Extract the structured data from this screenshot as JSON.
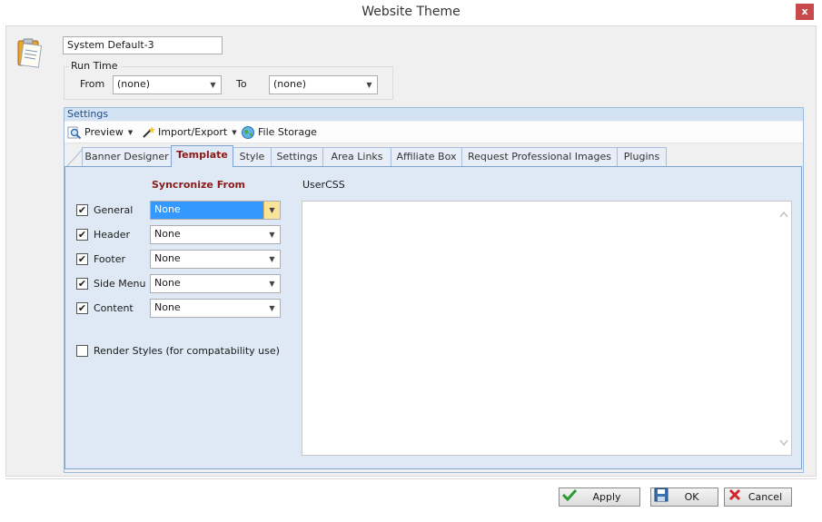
{
  "window": {
    "title": "Website Theme",
    "close_glyph": "x"
  },
  "theme_name": "System Default-3",
  "run_time": {
    "legend": "Run Time",
    "from_label": "From",
    "from_value": "(none)",
    "to_label": "To",
    "to_value": "(none)"
  },
  "settings": {
    "header": "Settings",
    "toolbar": {
      "preview": "Preview",
      "import_export": "Import/Export",
      "file_storage": "File Storage"
    },
    "tabs": [
      {
        "label": "Banner Designer"
      },
      {
        "label": "Template"
      },
      {
        "label": "Style"
      },
      {
        "label": "Settings"
      },
      {
        "label": "Area Links"
      },
      {
        "label": "Affiliate Box"
      },
      {
        "label": "Request Professional Images"
      },
      {
        "label": "Plugins"
      }
    ],
    "active_tab": "Template"
  },
  "template": {
    "sync_title": "Syncronize From",
    "usercss_label": "UserCSS",
    "usercss_value": "",
    "rows": [
      {
        "label": "General",
        "checked": true,
        "value": "None"
      },
      {
        "label": "Header",
        "checked": true,
        "value": "None"
      },
      {
        "label": "Footer",
        "checked": true,
        "value": "None"
      },
      {
        "label": "Side Menu",
        "checked": true,
        "value": "None"
      },
      {
        "label": "Content",
        "checked": true,
        "value": "None"
      }
    ],
    "render_styles": {
      "label": "Render Styles (for compatability use)",
      "checked": false
    }
  },
  "buttons": {
    "apply": "Apply",
    "ok": "OK",
    "cancel": "Cancel"
  },
  "colors": {
    "active_tab_text": "#8b1a1a",
    "close_button": "#c7494b",
    "selection": "#3399ff"
  },
  "icons": [
    "clipboard-icon",
    "preview-magnifier-icon",
    "wand-icon",
    "globe-icon",
    "checkmark-icon",
    "save-disk-icon",
    "cancel-x-icon"
  ]
}
